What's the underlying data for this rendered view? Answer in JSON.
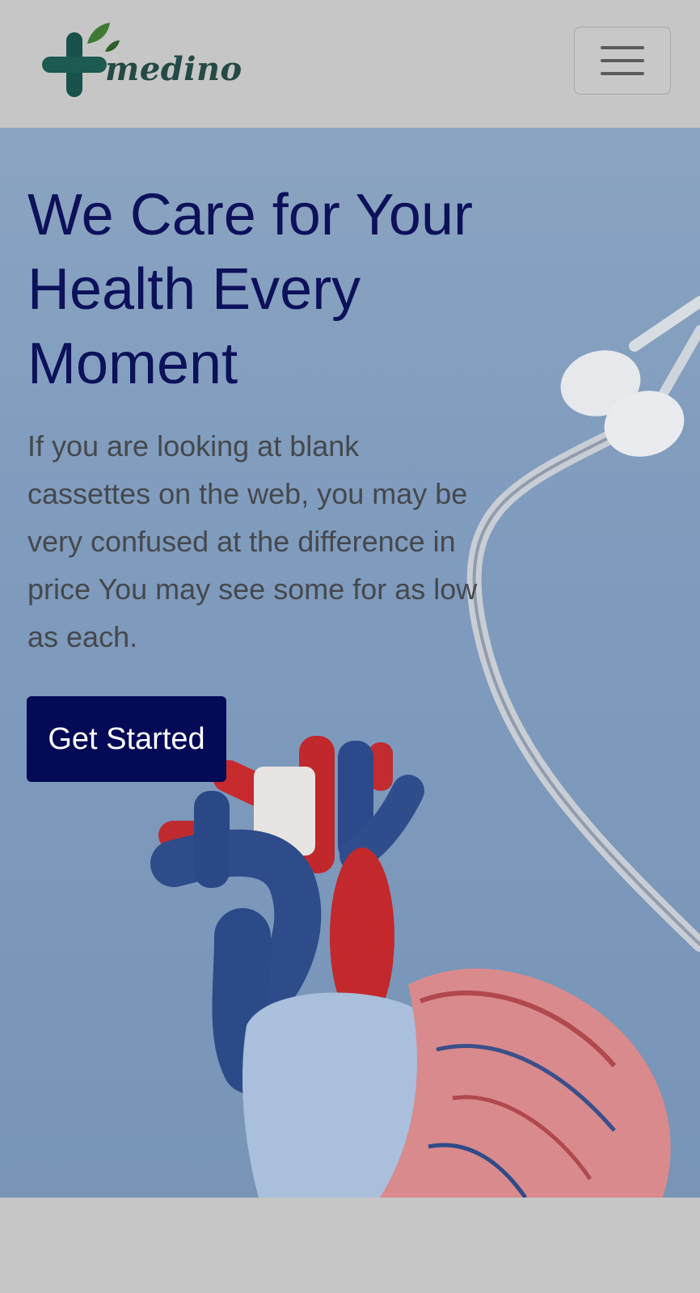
{
  "header": {
    "logo_text": "medino",
    "menu_icon": "hamburger-menu-icon"
  },
  "hero": {
    "headline": "We Care for Your Health Every Moment",
    "description": "If you are looking at blank cassettes on the web, you may be very confused at the difference in price You may see some for as low as each.",
    "cta_label": "Get Started",
    "illustration_icons": [
      "stethoscope-icon",
      "anatomical-heart-icon"
    ]
  },
  "colors": {
    "page_background": "#c6c6c6",
    "hero_background": "#8aa4c1",
    "headline": "#0c115a",
    "body_text": "#45484d",
    "cta_background": "#050a57",
    "cta_text": "#ffffff",
    "logo_cross": "#1d5a51",
    "logo_leaf": "#3f7a35"
  }
}
